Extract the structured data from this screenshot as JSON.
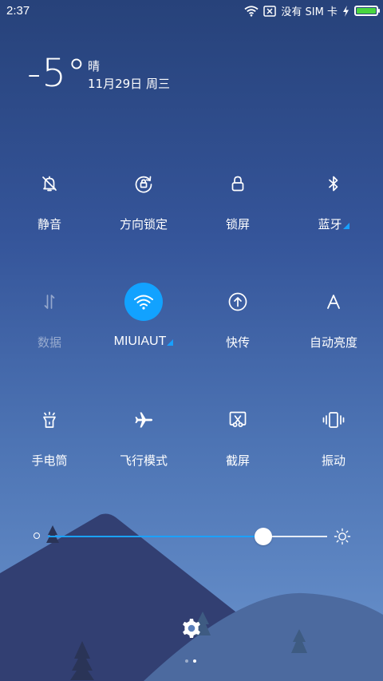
{
  "status_bar": {
    "time": "2:37",
    "sim_text": "没有 SIM 卡",
    "battery_level": 1.0,
    "icons": [
      "wifi-icon",
      "no-sim-icon",
      "charging-icon",
      "battery-icon"
    ]
  },
  "weather": {
    "temperature": "-5°",
    "condition": "晴",
    "date": "11月29日 周三"
  },
  "tiles": [
    {
      "label": "静音",
      "icon": "bell-off-icon",
      "active": false,
      "dim": false,
      "expandable": false
    },
    {
      "label": "方向锁定",
      "icon": "rotation-lock-icon",
      "active": false,
      "dim": false,
      "expandable": false
    },
    {
      "label": "锁屏",
      "icon": "lock-icon",
      "active": false,
      "dim": false,
      "expandable": false
    },
    {
      "label": "蓝牙",
      "icon": "bluetooth-icon",
      "active": false,
      "dim": false,
      "expandable": true
    },
    {
      "label": "数据",
      "icon": "mobile-data-icon",
      "active": false,
      "dim": true,
      "expandable": false
    },
    {
      "label": "MIUIAUT",
      "icon": "wifi-icon",
      "active": true,
      "dim": false,
      "expandable": true
    },
    {
      "label": "快传",
      "icon": "quick-transfer-icon",
      "active": false,
      "dim": false,
      "expandable": false
    },
    {
      "label": "自动亮度",
      "icon": "auto-brightness-icon",
      "active": false,
      "dim": false,
      "expandable": false
    },
    {
      "label": "手电筒",
      "icon": "flashlight-icon",
      "active": false,
      "dim": false,
      "expandable": false
    },
    {
      "label": "飞行模式",
      "icon": "airplane-icon",
      "active": false,
      "dim": false,
      "expandable": false
    },
    {
      "label": "截屏",
      "icon": "screenshot-icon",
      "active": false,
      "dim": false,
      "expandable": false
    },
    {
      "label": "振动",
      "icon": "vibrate-icon",
      "active": false,
      "dim": false,
      "expandable": false
    }
  ],
  "brightness": {
    "level": 0.77,
    "fill_color": "#1aa2ff"
  },
  "pager": {
    "pages": 2,
    "current": 2
  },
  "colors": {
    "accent": "#12a2ff",
    "battery": "#49d63f"
  }
}
